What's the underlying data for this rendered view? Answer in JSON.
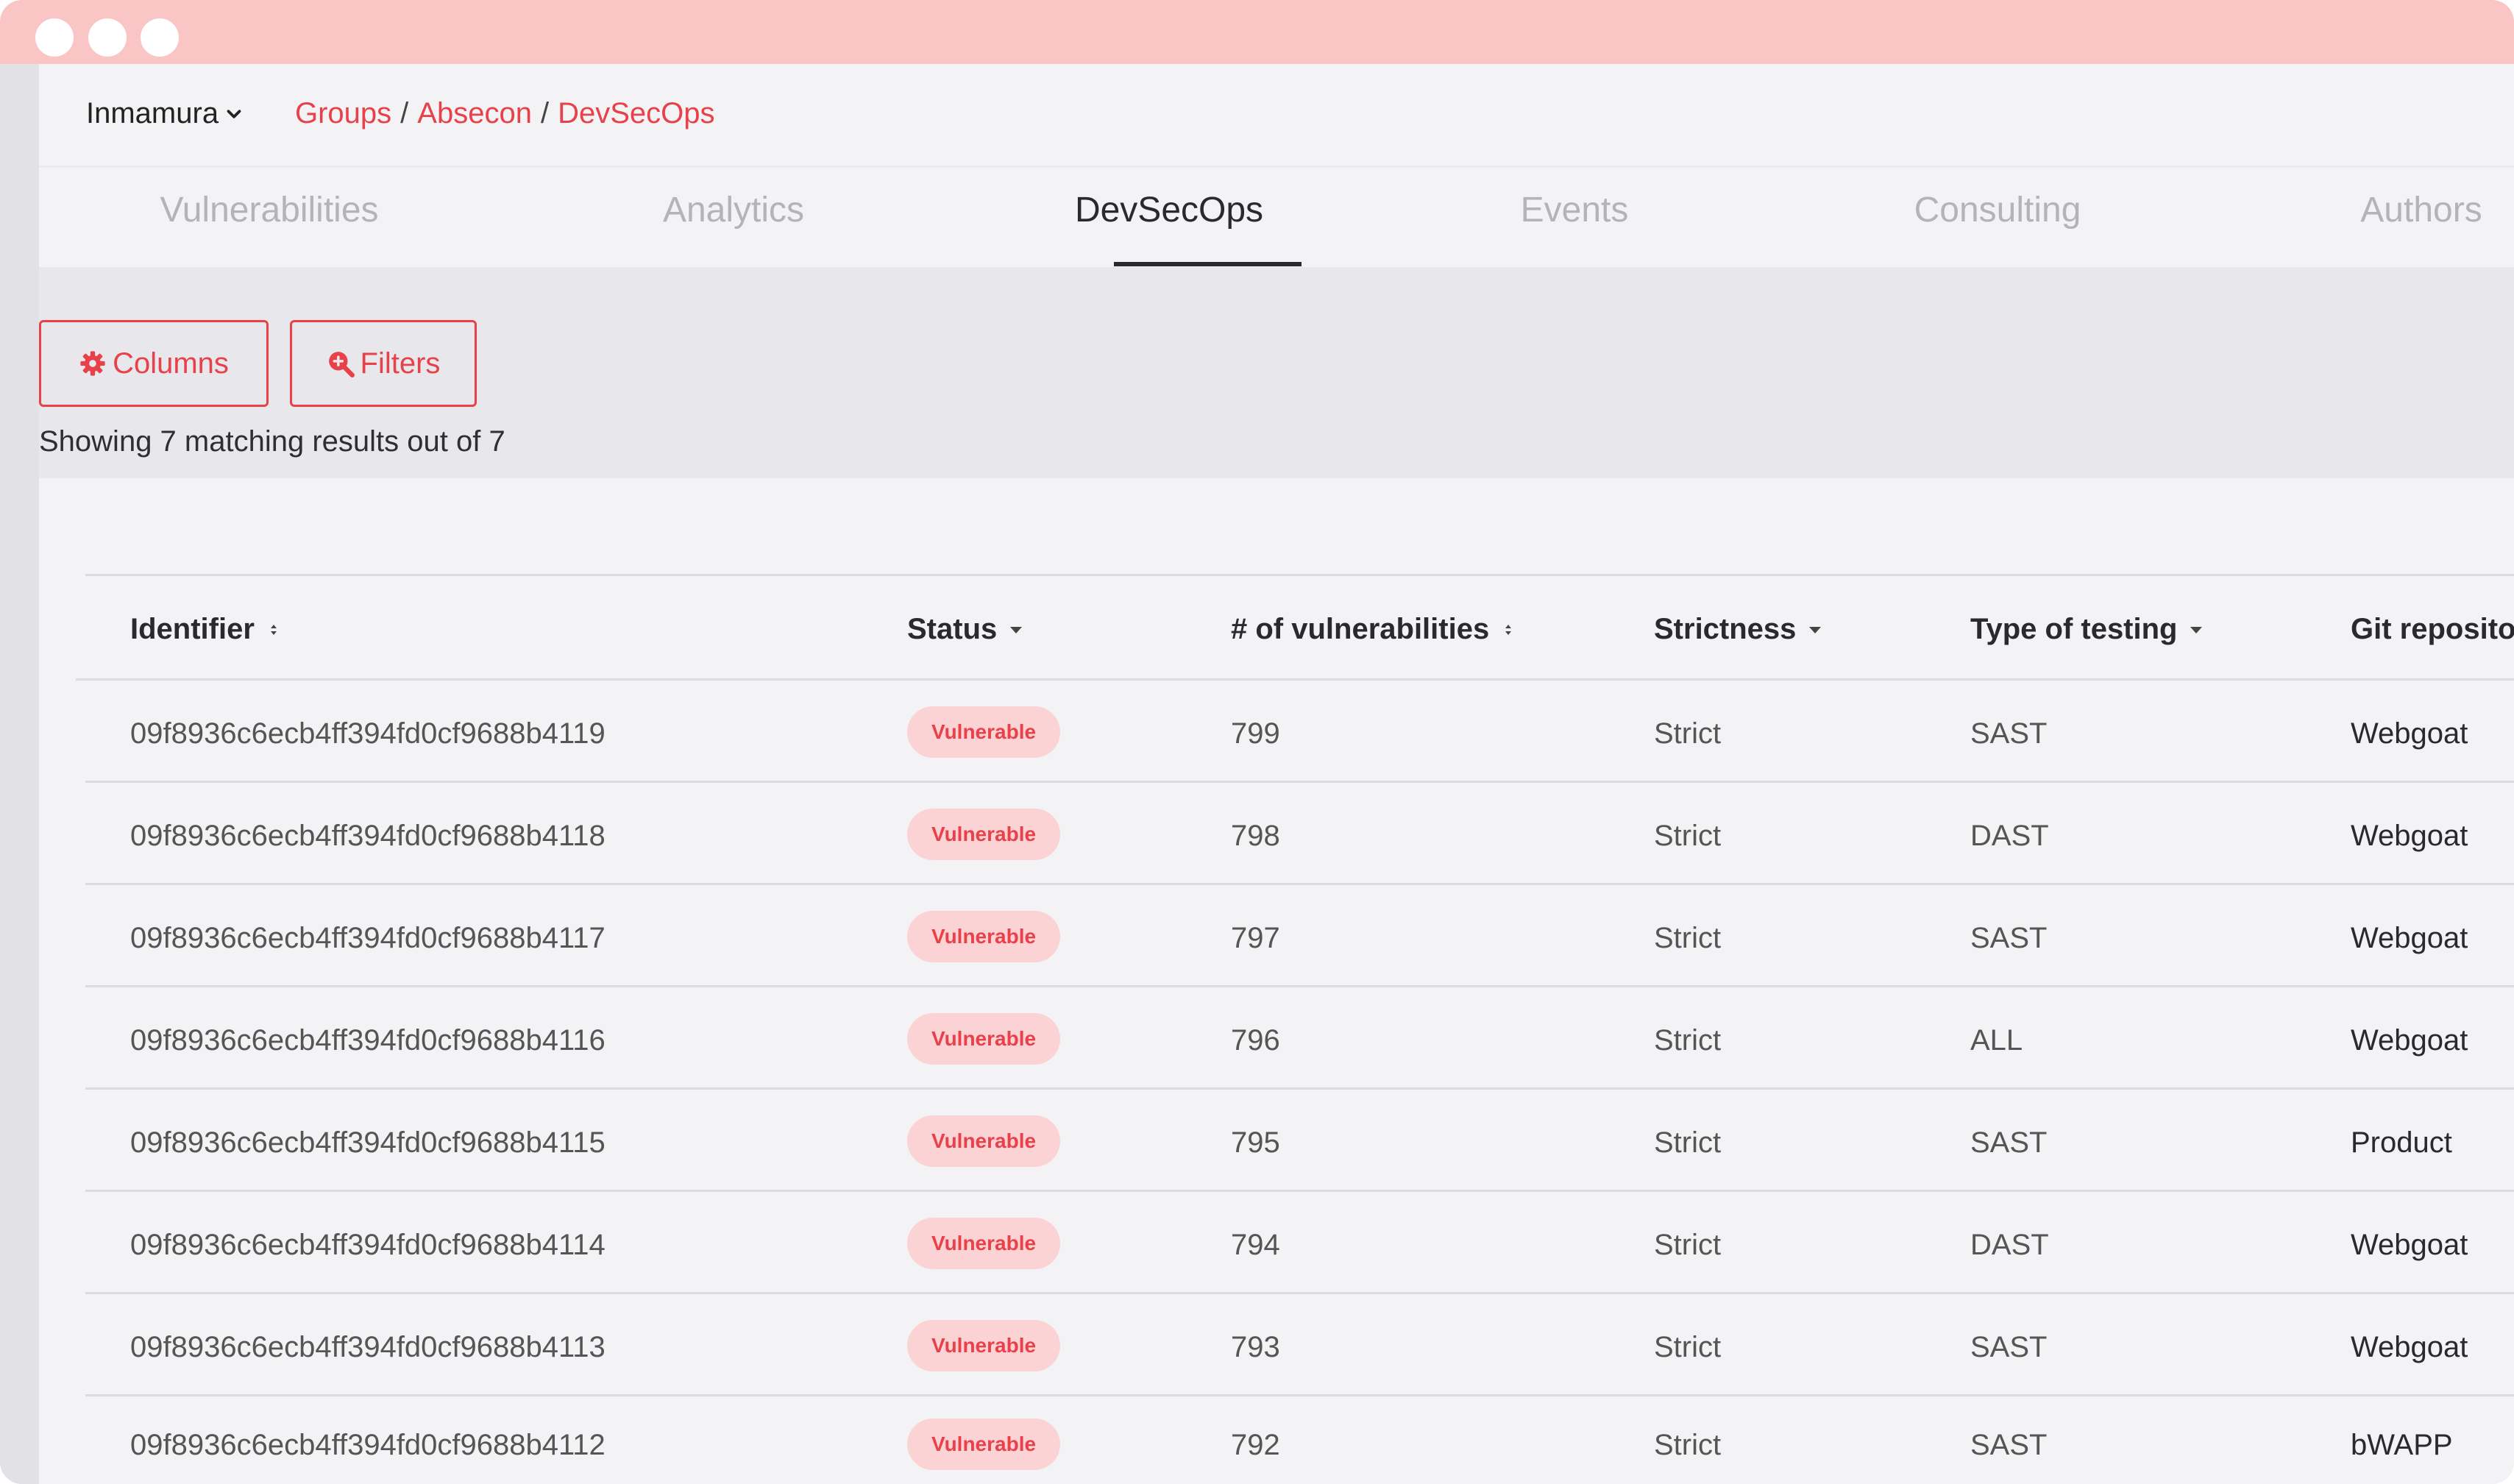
{
  "header": {
    "org_selector": "Inmamura",
    "breadcrumb": [
      "Groups",
      "Absecon",
      "DevSecOps"
    ],
    "separator": "/"
  },
  "tabs": [
    {
      "label": "Vulnerabilities",
      "active": false
    },
    {
      "label": "Analytics",
      "active": false
    },
    {
      "label": "DevSecOps",
      "active": true
    },
    {
      "label": "Events",
      "active": false
    },
    {
      "label": "Consulting",
      "active": false
    },
    {
      "label": "Authors",
      "active": false
    }
  ],
  "toolbar": {
    "columns_label": "Columns",
    "filters_label": "Filters",
    "summary": "Showing 7 matching results out of 7"
  },
  "table": {
    "columns": [
      "Identifier",
      "Status",
      "# of vulnerabilities",
      "Strictness",
      "Type of testing",
      "Git repositor"
    ],
    "rows": [
      {
        "identifier": "09f8936c6ecb4ff394fd0cf9688b4119",
        "status": "Vulnerable",
        "vulns": "799",
        "strictness": "Strict",
        "testing": "SAST",
        "repo": "Webgoat"
      },
      {
        "identifier": "09f8936c6ecb4ff394fd0cf9688b4118",
        "status": "Vulnerable",
        "vulns": "798",
        "strictness": "Strict",
        "testing": "DAST",
        "repo": "Webgoat"
      },
      {
        "identifier": "09f8936c6ecb4ff394fd0cf9688b4117",
        "status": "Vulnerable",
        "vulns": "797",
        "strictness": "Strict",
        "testing": "SAST",
        "repo": "Webgoat"
      },
      {
        "identifier": "09f8936c6ecb4ff394fd0cf9688b4116",
        "status": "Vulnerable",
        "vulns": "796",
        "strictness": "Strict",
        "testing": "ALL",
        "repo": "Webgoat"
      },
      {
        "identifier": "09f8936c6ecb4ff394fd0cf9688b4115",
        "status": "Vulnerable",
        "vulns": "795",
        "strictness": "Strict",
        "testing": "SAST",
        "repo": "Product"
      },
      {
        "identifier": "09f8936c6ecb4ff394fd0cf9688b4114",
        "status": "Vulnerable",
        "vulns": "794",
        "strictness": "Strict",
        "testing": "DAST",
        "repo": "Webgoat"
      },
      {
        "identifier": "09f8936c6ecb4ff394fd0cf9688b4113",
        "status": "Vulnerable",
        "vulns": "793",
        "strictness": "Strict",
        "testing": "SAST",
        "repo": "Webgoat"
      },
      {
        "identifier": "09f8936c6ecb4ff394fd0cf9688b4112",
        "status": "Vulnerable",
        "vulns": "792",
        "strictness": "Strict",
        "testing": "SAST",
        "repo": "bWAPP"
      }
    ]
  },
  "icons": {
    "org_caret": "chevron-down-icon",
    "columns": "gear-icon",
    "filters": "search-icon",
    "sort": "sort-icon",
    "filter_caret": "caret-down-icon"
  },
  "colors": {
    "accent": "#e8414a",
    "titlebar": "#f9c5c5",
    "badge_bg": "#fcd3d4"
  }
}
